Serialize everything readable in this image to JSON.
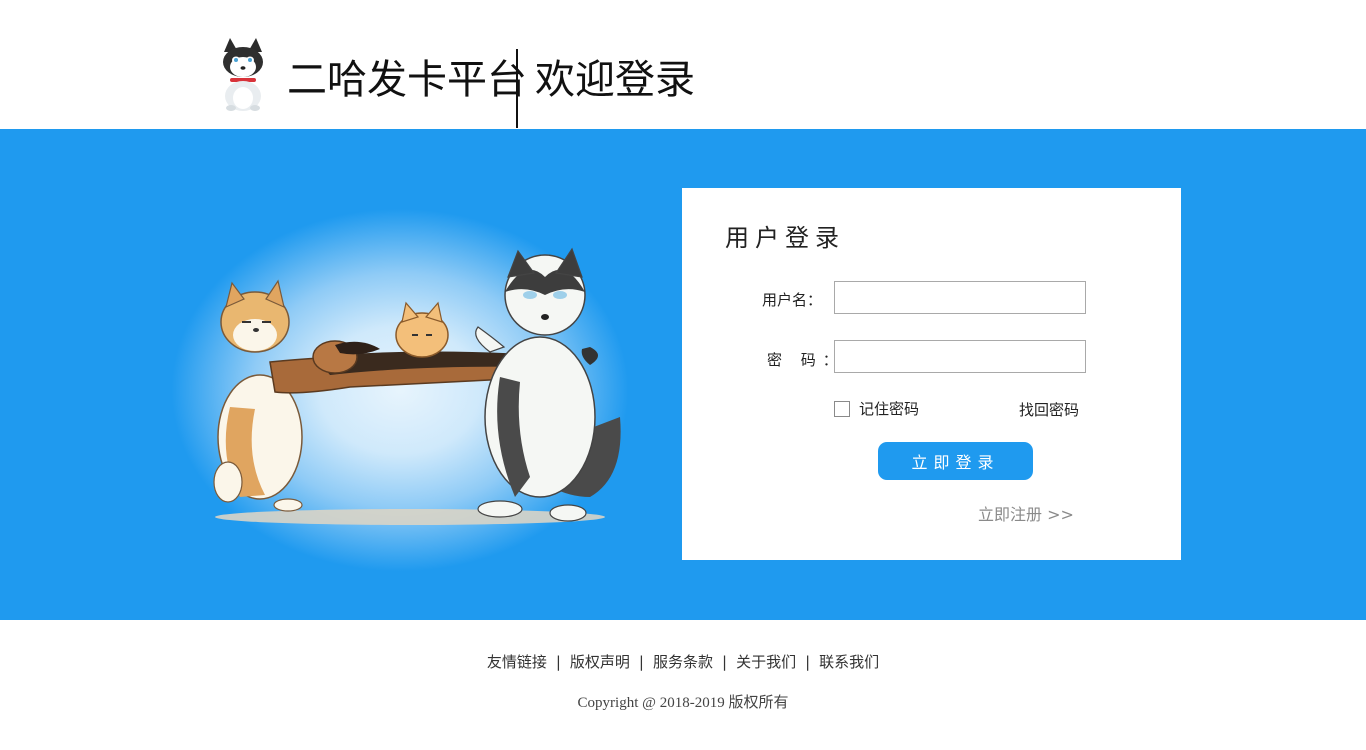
{
  "header": {
    "site_name": "二哈发卡平台",
    "welcome": "欢迎登录",
    "logo_icon": "husky-logo-icon"
  },
  "banner": {
    "background_color": "#1f9aef",
    "illustration": "cartoon-dogs-tug-of-war"
  },
  "login": {
    "title": "用户登录",
    "username_label": "用户名：",
    "username_value": "",
    "password_label": "密 码：",
    "password_value": "",
    "remember_label": "记住密码",
    "remember_checked": false,
    "forgot_label": "找回密码",
    "submit_label": "立即登录",
    "register_label": "立即注册 >>"
  },
  "footer": {
    "links": [
      "友情链接",
      "版权声明",
      "服务条款",
      "关于我们",
      "联系我们"
    ],
    "separator": "|",
    "copyright": "Copyright @ 2018-2019 版权所有"
  },
  "colors": {
    "accent": "#1f9aef",
    "muted_text": "#8a8a8a"
  }
}
